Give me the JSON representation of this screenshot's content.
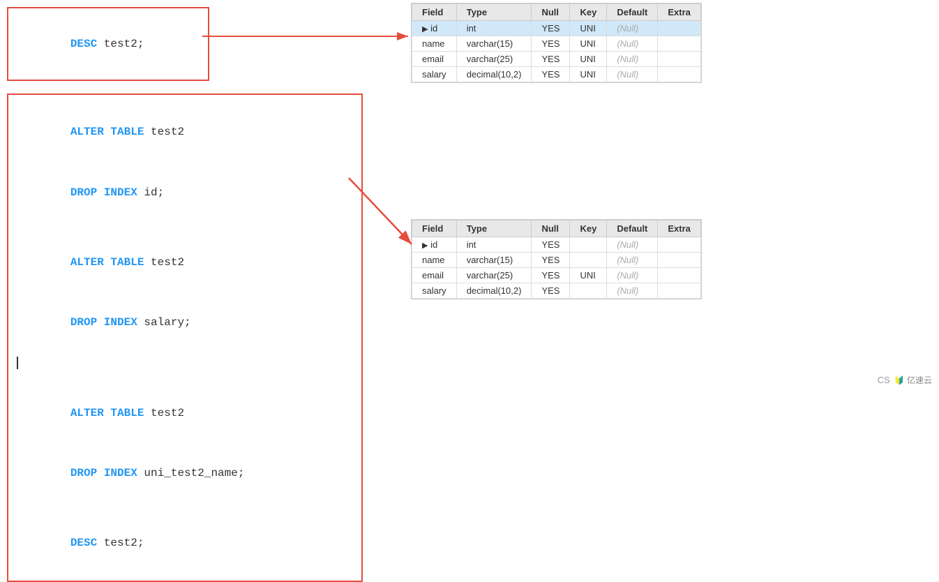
{
  "desc_box": {
    "line1_kw": "DESC",
    "line1_rest": " test2;"
  },
  "alter_box": {
    "block1_kw1": "ALTER TABLE",
    "block1_rest1": " test2",
    "block1_kw2": "DROP INDEX",
    "block1_rest2": " id;",
    "block2_kw1": "ALTER TABLE",
    "block2_rest1": " test2",
    "block2_kw2": "DROP INDEX",
    "block2_rest2": " salary;",
    "block3_kw1": "ALTER TABLE",
    "block3_rest1": " test2",
    "block3_kw2": "DROP INDEX",
    "block3_rest2": " uni_test2_name;",
    "desc_kw": "DESC",
    "desc_rest": " test2;"
  },
  "table1": {
    "headers": [
      "Field",
      "Type",
      "Null",
      "Key",
      "Default",
      "Extra"
    ],
    "rows": [
      {
        "field": "id",
        "type": "int",
        "null": "YES",
        "key": "UNI",
        "default": "(Null)",
        "extra": "",
        "selected": true,
        "arrow": true
      },
      {
        "field": "name",
        "type": "varchar(15)",
        "null": "YES",
        "key": "UNI",
        "default": "(Null)",
        "extra": ""
      },
      {
        "field": "email",
        "type": "varchar(25)",
        "null": "YES",
        "key": "UNI",
        "default": "(Null)",
        "extra": ""
      },
      {
        "field": "salary",
        "type": "decimal(10,2)",
        "null": "YES",
        "key": "UNI",
        "default": "(Null)",
        "extra": ""
      }
    ]
  },
  "table2": {
    "headers": [
      "Field",
      "Type",
      "Null",
      "Key",
      "Default",
      "Extra"
    ],
    "rows": [
      {
        "field": "id",
        "type": "int",
        "null": "YES",
        "key": "",
        "default": "(Null)",
        "extra": "",
        "arrow": true
      },
      {
        "field": "name",
        "type": "varchar(15)",
        "null": "YES",
        "key": "",
        "default": "(Null)",
        "extra": ""
      },
      {
        "field": "email",
        "type": "varchar(25)",
        "null": "YES",
        "key": "UNI",
        "default": "(Null)",
        "extra": ""
      },
      {
        "field": "salary",
        "type": "decimal(10,2)",
        "null": "YES",
        "key": "",
        "default": "(Null)",
        "extra": ""
      }
    ]
  },
  "watermark": {
    "cs": "CS",
    "brand": "🔰 亿速云"
  }
}
